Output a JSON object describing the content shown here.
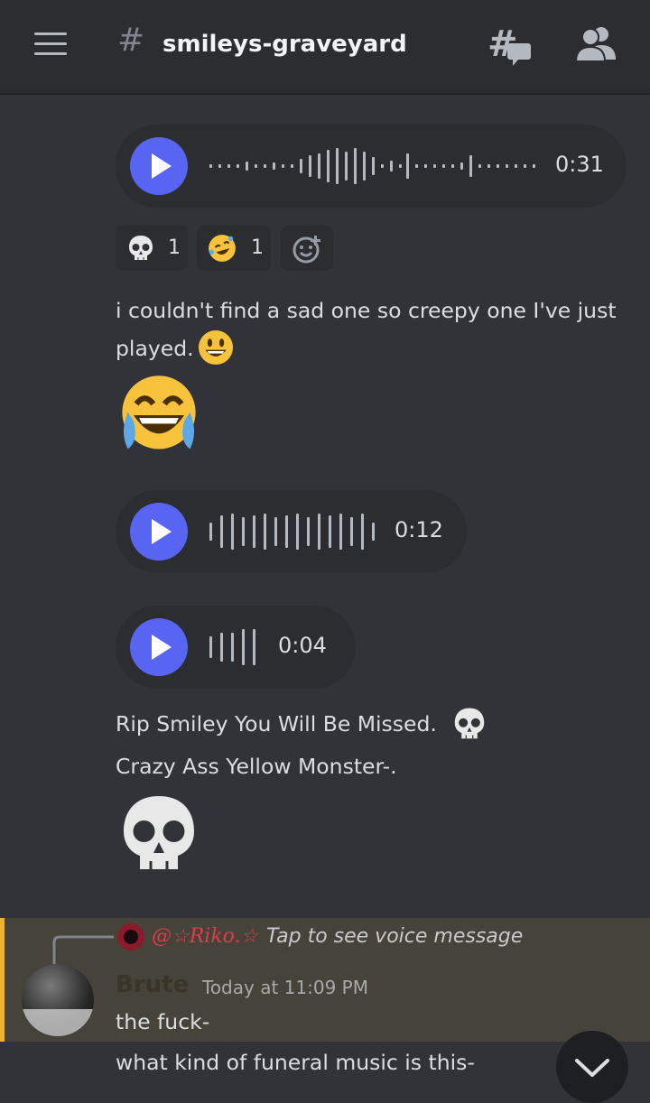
{
  "header": {
    "hash_symbol": "#",
    "channel_name": "smileys-graveyard",
    "icons": [
      "menu-icon",
      "threads-icon",
      "members-icon"
    ]
  },
  "voice_messages": [
    {
      "duration": "0:31"
    },
    {
      "duration": "0:12"
    },
    {
      "duration": "0:04"
    }
  ],
  "reactions": [
    {
      "emoji": "skull",
      "count": "1"
    },
    {
      "emoji": "rofl",
      "count": "1"
    },
    {
      "emoji": "add-reaction-icon"
    }
  ],
  "messages": {
    "line1": "i couldn't find a sad one so creepy one I've just",
    "line2": "played.",
    "rip": "Rip Smiley You Will Be Missed.",
    "crazy": "Crazy Ass Yellow Monster-."
  },
  "reply": {
    "mention": "@☆Riko.☆",
    "preview": "Tap to see voice message",
    "author": "Brute",
    "timestamp": "Today at 11:09 PM",
    "text1": "the fuck-",
    "text2": "what kind of funeral music is this-"
  },
  "colors": {
    "background": "#313338",
    "topbar": "#2b2d31",
    "accent": "#5865f2",
    "highlight_border": "#f0b232",
    "highlight_bg": "#45433a"
  }
}
